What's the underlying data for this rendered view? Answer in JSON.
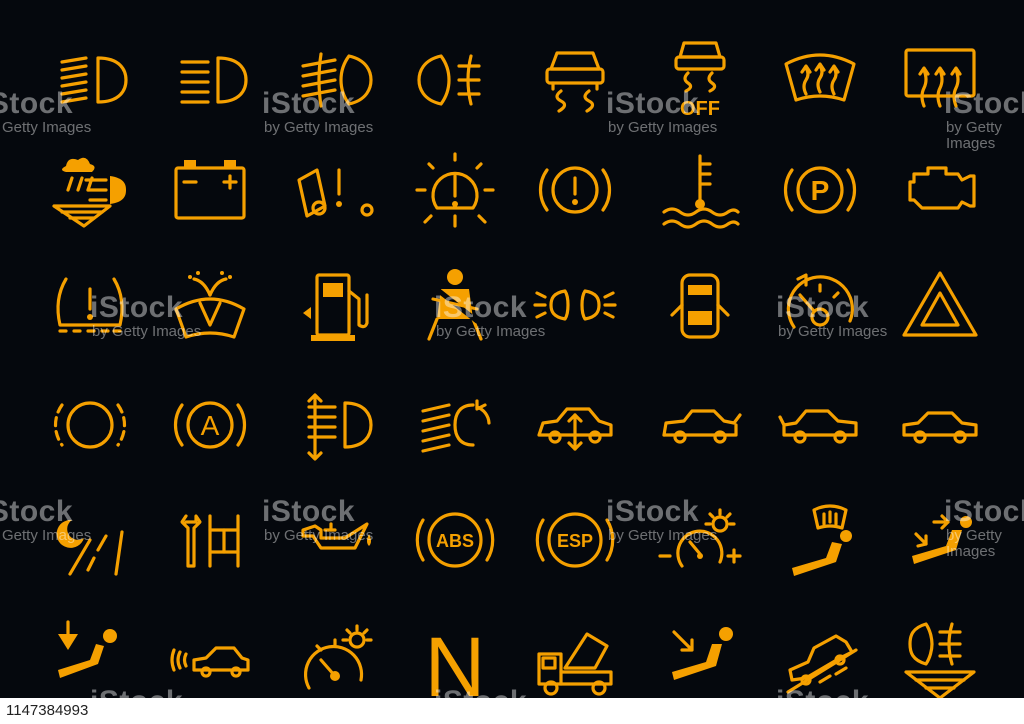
{
  "accent_color": "#f5a000",
  "background_color": "#05080d",
  "watermark": {
    "brand": "iStock",
    "credit": "by Getty Images",
    "trademark": "™"
  },
  "stock_id": "1147384993",
  "icons": [
    [
      "high-beam-icon",
      "low-beam-icon",
      "rear-fog-light-icon",
      "front-fog-light-icon",
      "traction-control-icon",
      "traction-control-off-icon",
      "windshield-defrost-icon",
      "rear-window-defrost-icon"
    ],
    [
      "rain-light-sensor-icon",
      "battery-icon",
      "door-warning-icon",
      "exterior-light-fault-icon",
      "brake-warning-icon",
      "coolant-temperature-icon",
      "parking-brake-icon",
      "check-engine-icon"
    ],
    [
      "tire-pressure-icon",
      "washer-fluid-icon",
      "low-fuel-icon",
      "seatbelt-icon",
      "side-lights-icon",
      "door-open-icon",
      "cruise-control-icon",
      "hazard-triangle-icon"
    ],
    [
      "brake-pad-icon",
      "auto-start-stop-icon",
      "headlight-leveling-icon",
      "adaptive-headlight-icon",
      "suspension-icon",
      "hood-open-icon",
      "trunk-open-icon",
      "car-outline-icon"
    ],
    [
      "night-lane-assist-icon",
      "service-wrench-icon",
      "oil-pressure-icon",
      "abs-icon",
      "esp-icon",
      "dimmer-icon",
      "windshield-airflow-icon",
      "recirculation-airflow-icon"
    ],
    [
      "footwell-airflow-icon",
      "parking-sensor-icon",
      "speedometer-brightness-icon",
      "gear-neutral-icon",
      "tipper-truck-icon",
      "face-airflow-icon",
      "hill-descent-icon",
      "fog-light-rain-icon"
    ]
  ],
  "labels": {
    "traction_off": "OFF",
    "abs": "ABS",
    "esp": "ESP",
    "parking": "P",
    "auto": "A",
    "neutral": "N"
  }
}
